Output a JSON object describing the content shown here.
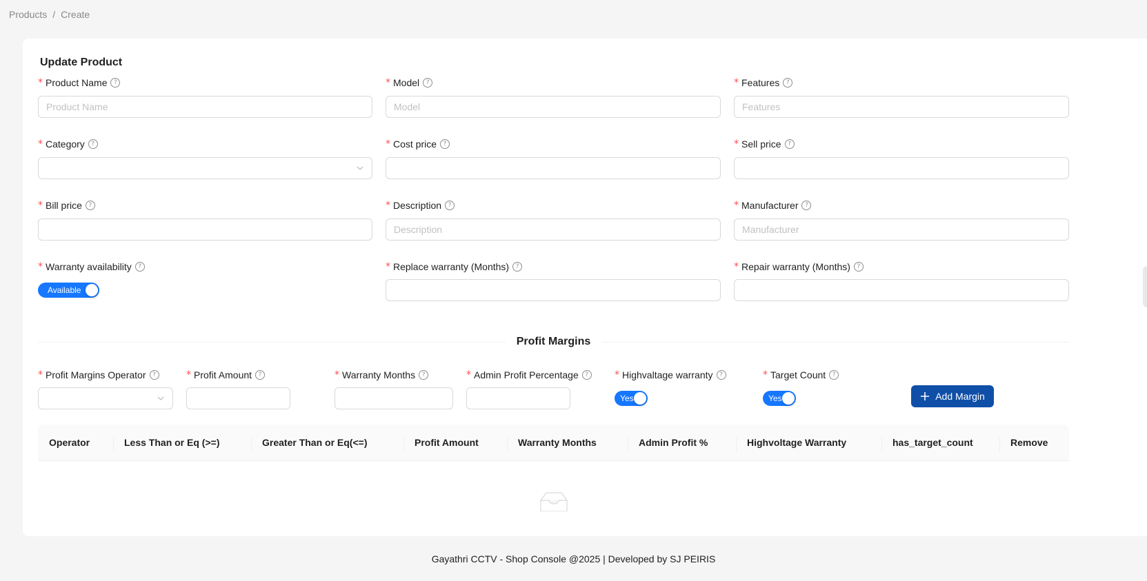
{
  "breadcrumb": {
    "items": [
      "Products",
      "Create"
    ],
    "separator": "/"
  },
  "form": {
    "title": "Update Product",
    "fields": {
      "product_name": {
        "label": "Product Name",
        "placeholder": "Product Name",
        "value": ""
      },
      "model": {
        "label": "Model",
        "placeholder": "Model",
        "value": ""
      },
      "features": {
        "label": "Features",
        "placeholder": "Features",
        "value": ""
      },
      "category": {
        "label": "Category",
        "value": ""
      },
      "cost_price": {
        "label": "Cost price",
        "value": ""
      },
      "sell_price": {
        "label": "Sell price",
        "value": ""
      },
      "bill_price": {
        "label": "Bill price",
        "value": ""
      },
      "description": {
        "label": "Description",
        "placeholder": "Description",
        "value": ""
      },
      "manufacturer": {
        "label": "Manufacturer",
        "placeholder": "Manufacturer",
        "value": ""
      },
      "warranty_availability": {
        "label": "Warranty availability",
        "switch_text": "Available",
        "checked": true
      },
      "replace_warranty": {
        "label": "Replace warranty (Months)",
        "value": ""
      },
      "repair_warranty": {
        "label": "Repair warranty (Months)",
        "value": ""
      }
    }
  },
  "profit_margins": {
    "section_title": "Profit Margins",
    "fields": {
      "operator": {
        "label": "Profit Margins Operator",
        "value": ""
      },
      "profit_amount": {
        "label": "Profit Amount",
        "value": ""
      },
      "warranty_months": {
        "label": "Warranty Months",
        "value": ""
      },
      "admin_profit_percentage": {
        "label": "Admin Profit Percentage",
        "value": ""
      },
      "highvoltage_warranty": {
        "label": "Highvaltage warranty",
        "switch_text": "Yes",
        "checked": true
      },
      "target_count": {
        "label": "Target Count",
        "switch_text": "Yes",
        "checked": true
      }
    },
    "add_button_label": "Add Margin",
    "table": {
      "columns": [
        "Operator",
        "Less Than or Eq (>=)",
        "Greater Than or Eq(<=)",
        "Profit Amount",
        "Warranty Months",
        "Admin Profit %",
        "Highvoltage Warranty",
        "has_target_count",
        "Remove"
      ],
      "rows": []
    }
  },
  "footer": {
    "text": "Gayathri CCTV - Shop Console @2025 | Developed by SJ PEIRIS"
  },
  "colors": {
    "primary": "#1677ff",
    "button": "#0f4fa8",
    "required": "#ff4d4f",
    "background": "#f5f5f5"
  }
}
